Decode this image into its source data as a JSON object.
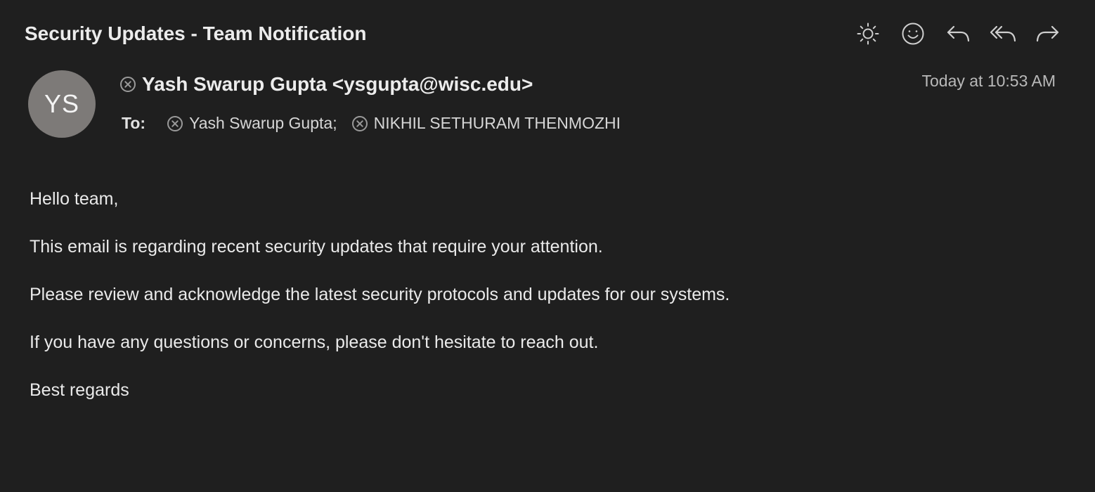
{
  "email": {
    "subject": "Security Updates - Team Notification",
    "sender": {
      "initials": "YS",
      "display": "Yash Swarup Gupta <ysgupta@wisc.edu>"
    },
    "date": "Today at 10:53 AM",
    "to_label": "To:",
    "recipients": [
      "Yash Swarup Gupta;",
      "NIKHIL SETHURAM THENMOZHI"
    ],
    "body": [
      "Hello team,",
      "This email is regarding recent security updates that require your attention.",
      "Please review and acknowledge the latest security protocols and updates for our systems.",
      "If you have any questions or concerns, please don't hesitate to reach out.",
      "Best regards"
    ]
  },
  "toolbar": {
    "icons": [
      "sun-icon",
      "smiley-icon",
      "reply-icon",
      "reply-all-icon",
      "forward-icon"
    ]
  },
  "colors": {
    "background": "#1f1f1f",
    "avatar": "#7d7a78",
    "text": "#eaeaea",
    "muted": "#b9b9b9"
  }
}
